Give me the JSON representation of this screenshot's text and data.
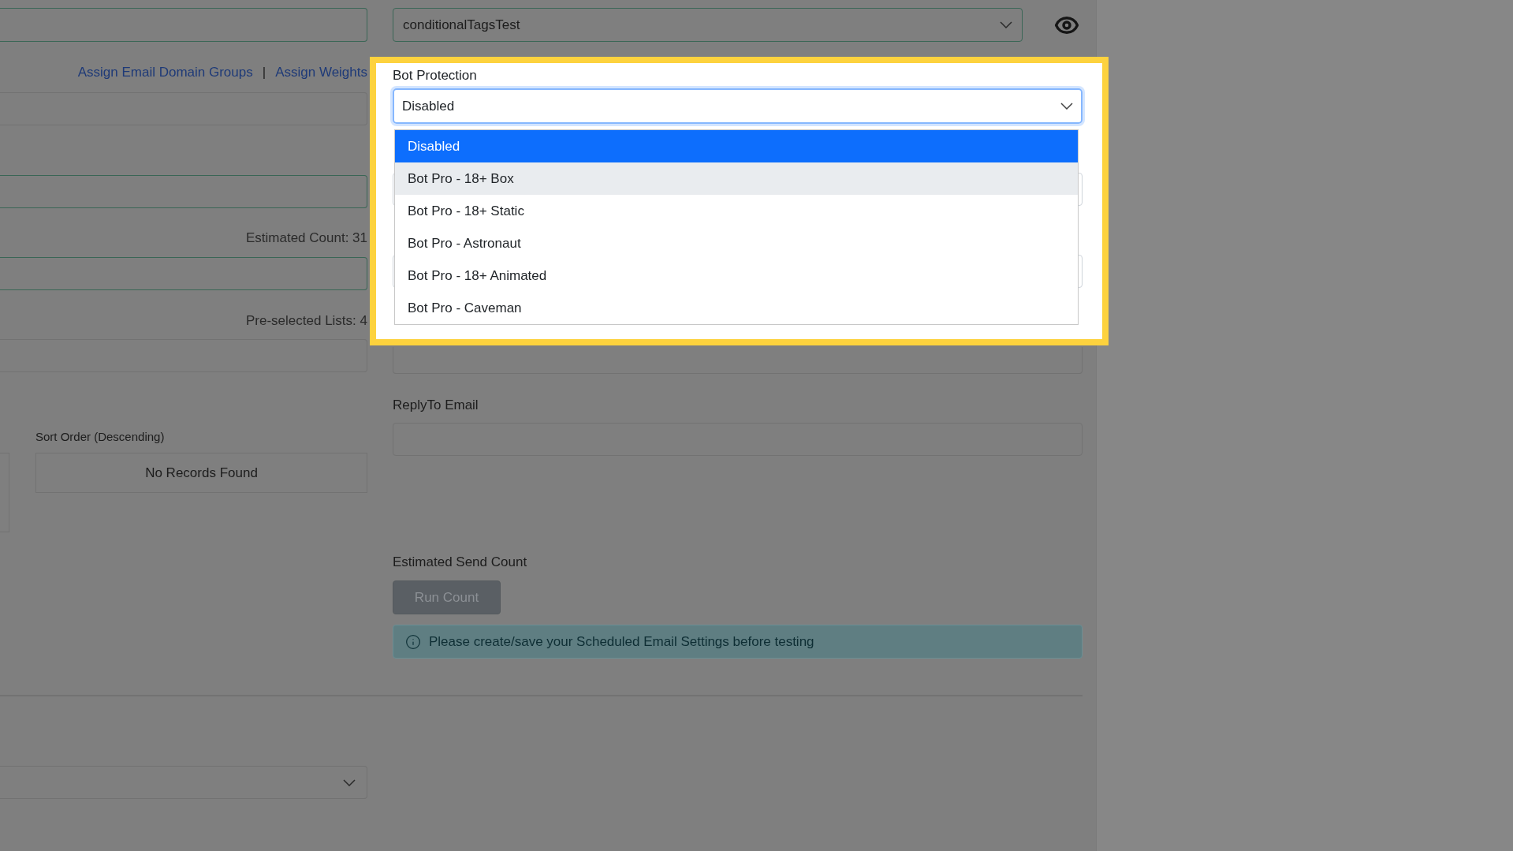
{
  "left": {
    "links": [
      "Assign Email Domain Groups",
      "Assign Weights"
    ],
    "separator": "|",
    "estimated_count": "Estimated Count: 31",
    "preselected_lists": "Pre-selected Lists: 4",
    "sort_order": {
      "label": "Sort Order (Descending)",
      "empty_text": "No Records Found"
    }
  },
  "template_select": {
    "value": "conditionalTagsTest"
  },
  "bot_protection": {
    "label": "Bot Protection",
    "value": "Disabled",
    "options": [
      {
        "label": "Disabled",
        "selected": true,
        "highlighted": false
      },
      {
        "label": "Bot Pro - 18+ Box",
        "selected": false,
        "highlighted": true
      },
      {
        "label": "Bot Pro - 18+ Static",
        "selected": false,
        "highlighted": false
      },
      {
        "label": "Bot Pro - Astronaut",
        "selected": false,
        "highlighted": false
      },
      {
        "label": "Bot Pro - 18+ Animated",
        "selected": false,
        "highlighted": false
      },
      {
        "label": "Bot Pro - Caveman",
        "selected": false,
        "highlighted": false
      }
    ]
  },
  "reply_to": {
    "label": "ReplyTo Email"
  },
  "estimated_send_count": {
    "label": "Estimated Send Count",
    "button": "Run Count",
    "button_disabled": true,
    "alert": "Please create/save your Scheduled Email Settings before testing"
  }
}
